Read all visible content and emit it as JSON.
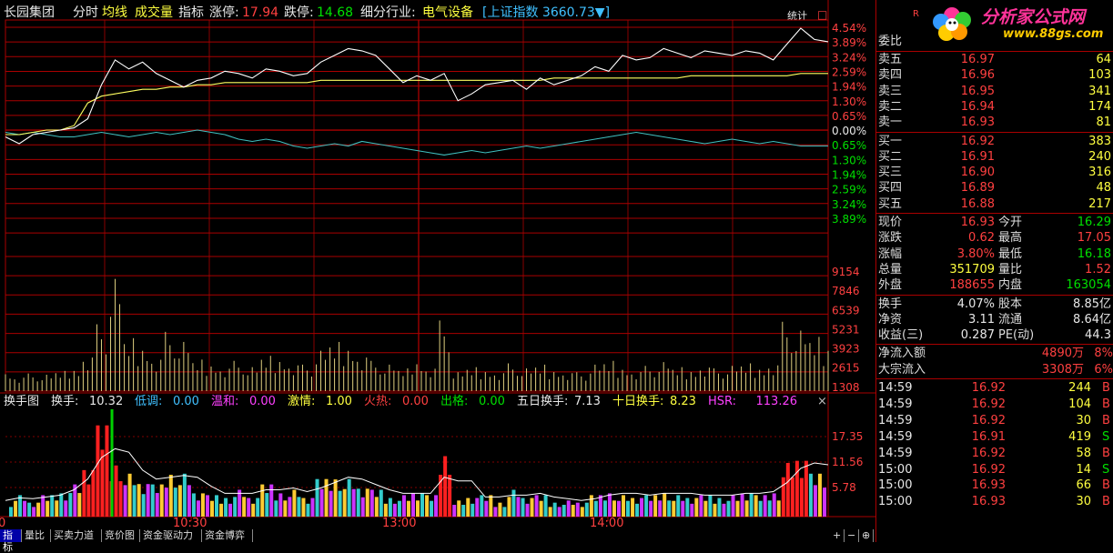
{
  "header": {
    "stock_name": "长园集团",
    "mode_fenshi": "分时",
    "mode_junxian": "均线",
    "mode_volume": "成交量",
    "mode_indicator": "指标",
    "limit_up_label": "涨停:",
    "limit_up_value": "17.94",
    "limit_down_label": "跌停:",
    "limit_down_value": "14.68",
    "industry_label": "细分行业:",
    "industry_value": "电气设备",
    "index_text": "[上证指数 3660.73▼]",
    "stats_button": "统计",
    "close_box": "□"
  },
  "price_axis_labels": [
    {
      "text": "4.54%",
      "color": "#ff4040"
    },
    {
      "text": "3.89%",
      "color": "#ff4040"
    },
    {
      "text": "3.24%",
      "color": "#ff4040"
    },
    {
      "text": "2.59%",
      "color": "#ff4040"
    },
    {
      "text": "1.94%",
      "color": "#ff4040"
    },
    {
      "text": "1.30%",
      "color": "#ff4040"
    },
    {
      "text": "0.65%",
      "color": "#ff4040"
    },
    {
      "text": "0.00%",
      "color": "#e8e8e8"
    },
    {
      "text": "0.65%",
      "color": "#00e000"
    },
    {
      "text": "1.30%",
      "color": "#00e000"
    },
    {
      "text": "1.94%",
      "color": "#00e000"
    },
    {
      "text": "2.59%",
      "color": "#00e000"
    },
    {
      "text": "3.24%",
      "color": "#00e000"
    },
    {
      "text": "3.89%",
      "color": "#00e000"
    }
  ],
  "volume_axis_labels": [
    "9154",
    "7846",
    "6539",
    "5231",
    "3923",
    "2615",
    "1308"
  ],
  "indicator": {
    "title": "换手图",
    "items": [
      {
        "label": "换手: ",
        "value": "10.32",
        "color": "#e8e8e8"
      },
      {
        "label": "低调: ",
        "value": "0.00",
        "color": "#40c0ff"
      },
      {
        "label": "温和: ",
        "value": "0.00",
        "color": "#ff40ff"
      },
      {
        "label": "激情: ",
        "value": "1.00",
        "color": "#ffff40"
      },
      {
        "label": "火热: ",
        "value": "0.00",
        "color": "#ff4040"
      },
      {
        "label": "出格: ",
        "value": "0.00",
        "color": "#00e000"
      },
      {
        "label": "五日换手: ",
        "value": "7.13",
        "color": "#e8e8e8"
      },
      {
        "label": "十日换手: ",
        "value": "8.23",
        "color": "#ffff40"
      },
      {
        "label": "HSR: ",
        "value": "113.26",
        "color": "#ff40ff"
      }
    ],
    "axis_labels": [
      "17.35",
      "11.56",
      "5.78"
    ],
    "close": "×"
  },
  "time_labels": [
    "0",
    "10:30",
    "13:00",
    "14:00"
  ],
  "bottom_tabs": [
    "指标",
    "量比",
    "买卖力道",
    "竞价图",
    "资金驱动力",
    "资金博弈"
  ],
  "bottom_buttons": [
    "+",
    "−",
    "⊕"
  ],
  "right_panel": {
    "r_label": "R",
    "logo_text": "分析家公式网",
    "logo_url": "www.88gs.com",
    "weibi_label": "委比",
    "sell": [
      {
        "label": "卖五",
        "price": "16.97",
        "vol": "64"
      },
      {
        "label": "卖四",
        "price": "16.96",
        "vol": "103"
      },
      {
        "label": "卖三",
        "price": "16.95",
        "vol": "341"
      },
      {
        "label": "卖二",
        "price": "16.94",
        "vol": "174"
      },
      {
        "label": "卖一",
        "price": "16.93",
        "vol": "81"
      }
    ],
    "buy": [
      {
        "label": "买一",
        "price": "16.92",
        "vol": "383"
      },
      {
        "label": "买二",
        "price": "16.91",
        "vol": "240"
      },
      {
        "label": "买三",
        "price": "16.90",
        "vol": "316"
      },
      {
        "label": "买四",
        "price": "16.89",
        "vol": "48"
      },
      {
        "label": "买五",
        "price": "16.88",
        "vol": "217"
      }
    ],
    "stats1": [
      {
        "l1": "现价",
        "v1": "16.93",
        "c1": "red",
        "l2": "今开",
        "v2": "16.29",
        "c2": "grn"
      },
      {
        "l1": "涨跌",
        "v1": "0.62",
        "c1": "red",
        "l2": "最高",
        "v2": "17.05",
        "c2": "red"
      },
      {
        "l1": "涨幅",
        "v1": "3.80%",
        "c1": "red",
        "l2": "最低",
        "v2": "16.18",
        "c2": "grn"
      },
      {
        "l1": "总量",
        "v1": "351709",
        "c1": "yel",
        "l2": "量比",
        "v2": "1.52",
        "c2": "red"
      },
      {
        "l1": "外盘",
        "v1": "188655",
        "c1": "red",
        "l2": "内盘",
        "v2": "163054",
        "c2": "grn"
      }
    ],
    "stats2": [
      {
        "l1": "换手",
        "v1": "4.07%",
        "l2": "股本",
        "v2": "8.85亿"
      },
      {
        "l1": "净资",
        "v1": "3.11",
        "l2": "流通",
        "v2": "8.64亿"
      },
      {
        "l1": "收益(三)",
        "v1": "0.287",
        "l2": "PE(动)",
        "v2": "44.3"
      }
    ],
    "flow": [
      {
        "label": "净流入额",
        "value": "4890万",
        "pct": "8%"
      },
      {
        "label": "大宗流入",
        "value": "3308万",
        "pct": "6%"
      }
    ],
    "ticks": [
      {
        "time": "14:59",
        "price": "16.92",
        "vol": "244",
        "side": "B"
      },
      {
        "time": "14:59",
        "price": "16.92",
        "vol": "104",
        "side": "B"
      },
      {
        "time": "14:59",
        "price": "16.92",
        "vol": "30",
        "side": "B"
      },
      {
        "time": "14:59",
        "price": "16.91",
        "vol": "419",
        "side": "S"
      },
      {
        "time": "14:59",
        "price": "16.92",
        "vol": "58",
        "side": "B"
      },
      {
        "time": "15:00",
        "price": "16.92",
        "vol": "14",
        "side": "S"
      },
      {
        "time": "15:00",
        "price": "16.93",
        "vol": "66",
        "side": "B"
      },
      {
        "time": "15:00",
        "price": "16.93",
        "vol": "30",
        "side": "B"
      }
    ]
  },
  "chart_data": {
    "type": "line",
    "price_series_pct": [
      -0.3,
      -0.6,
      -0.2,
      -0.1,
      0.0,
      0.1,
      0.5,
      2.0,
      3.1,
      2.7,
      3.0,
      2.5,
      2.2,
      1.9,
      2.2,
      2.3,
      2.6,
      2.5,
      2.3,
      2.7,
      2.6,
      2.4,
      2.5,
      3.0,
      3.3,
      3.6,
      3.5,
      3.3,
      2.7,
      2.1,
      2.4,
      2.2,
      2.5,
      1.3,
      1.6,
      2.0,
      2.1,
      2.2,
      1.8,
      2.3,
      2.0,
      2.2,
      2.4,
      2.8,
      2.6,
      3.3,
      3.1,
      3.2,
      3.6,
      3.4,
      3.2,
      3.5,
      3.4,
      3.3,
      3.5,
      3.4,
      3.1,
      3.8,
      4.5,
      4.0,
      3.9
    ],
    "avg_series_pct": [
      -0.2,
      -0.2,
      -0.1,
      0.0,
      0.0,
      0.2,
      1.2,
      1.5,
      1.6,
      1.7,
      1.8,
      1.8,
      1.9,
      1.9,
      2.0,
      2.0,
      2.1,
      2.1,
      2.1,
      2.1,
      2.1,
      2.1,
      2.1,
      2.2,
      2.2,
      2.2,
      2.2,
      2.2,
      2.2,
      2.2,
      2.2,
      2.2,
      2.2,
      2.2,
      2.2,
      2.2,
      2.2,
      2.2,
      2.2,
      2.2,
      2.3,
      2.3,
      2.3,
      2.3,
      2.3,
      2.3,
      2.3,
      2.3,
      2.3,
      2.3,
      2.4,
      2.4,
      2.4,
      2.4,
      2.4,
      2.4,
      2.4,
      2.4,
      2.5,
      2.5,
      2.5
    ],
    "index_series_pct": [
      -0.1,
      -0.2,
      -0.1,
      -0.2,
      -0.3,
      -0.3,
      -0.2,
      -0.1,
      -0.2,
      -0.3,
      -0.2,
      -0.1,
      -0.2,
      -0.1,
      0.0,
      -0.1,
      -0.2,
      -0.4,
      -0.5,
      -0.4,
      -0.5,
      -0.7,
      -0.8,
      -0.7,
      -0.6,
      -0.7,
      -0.5,
      -0.6,
      -0.7,
      -0.8,
      -0.9,
      -1.0,
      -1.1,
      -1.0,
      -0.9,
      -1.0,
      -0.9,
      -0.8,
      -0.7,
      -0.8,
      -0.7,
      -0.6,
      -0.5,
      -0.4,
      -0.3,
      -0.2,
      -0.1,
      -0.2,
      -0.3,
      -0.4,
      -0.5,
      -0.6,
      -0.5,
      -0.4,
      -0.5,
      -0.6,
      -0.5,
      -0.6,
      -0.7,
      -0.7,
      -0.7
    ],
    "ylim_pct": [
      -4.54,
      4.54
    ],
    "volume": [
      1500,
      1200,
      1400,
      1300,
      1600,
      1800,
      3000,
      5300,
      8900,
      4200,
      3600,
      2800,
      4700,
      3900,
      2500,
      2200,
      2000,
      2400,
      1900,
      2800,
      2600,
      2300,
      2100,
      3200,
      3900,
      3600,
      3000,
      2400,
      2100,
      1800,
      2400,
      2000,
      5600,
      1500,
      1900,
      1700,
      1600,
      2200,
      1800,
      2100,
      1700,
      1600,
      1500,
      2100,
      2400,
      1900,
      1700,
      2000,
      2300,
      1900,
      1700,
      2100,
      1800,
      2000,
      2200,
      1900,
      2300,
      5500,
      4800,
      4300,
      3600
    ],
    "turnover": [
      3,
      4,
      3,
      4,
      5,
      6,
      10,
      17,
      11,
      8,
      7,
      6,
      9,
      8,
      5,
      4,
      4,
      5,
      4,
      6,
      5,
      5,
      4,
      7,
      8,
      7,
      6,
      5,
      4,
      4,
      5,
      4,
      13,
      3,
      4,
      4,
      3,
      5,
      4,
      4,
      3,
      3,
      3,
      4,
      5,
      4,
      4,
      4,
      5,
      4,
      4,
      4,
      4,
      4,
      5,
      4,
      5,
      10,
      12,
      8,
      9
    ]
  }
}
